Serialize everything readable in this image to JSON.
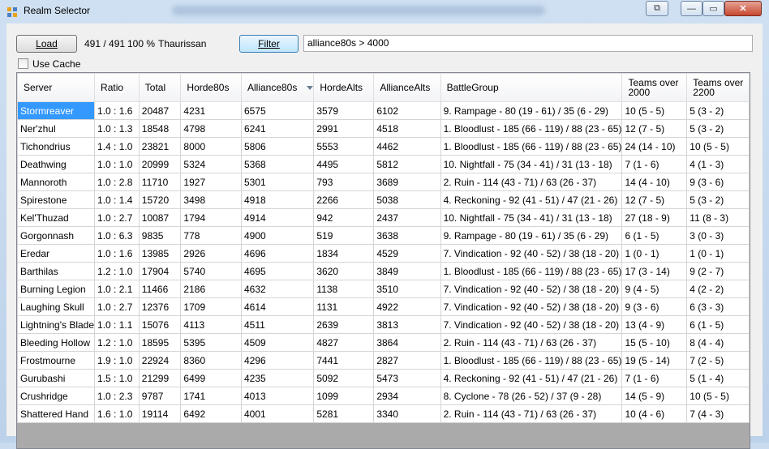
{
  "window": {
    "title": "Realm Selector",
    "buttons": {
      "restore_extra": "⧉",
      "minimize": "—",
      "maximize": "▭",
      "close": "✕"
    }
  },
  "toolbar": {
    "load_label": "Load",
    "count_text": "491 / 491",
    "percent_text": "100 %",
    "realm_name": "Thaurissan",
    "filter_label": "Filter",
    "filter_value": "alliance80s > 4000",
    "use_cache_label": "Use Cache"
  },
  "table": {
    "columns": [
      "Server",
      "Ratio",
      "Total",
      "Horde80s",
      "Alliance80s",
      "HordeAlts",
      "AllianceAlts",
      "BattleGroup",
      "Teams over 2000",
      "Teams over 2200"
    ],
    "rows": [
      [
        "Stormreaver",
        "1.0 : 1.6",
        "20487",
        "4231",
        "6575",
        "3579",
        "6102",
        "9.  Rampage - 80 (19 - 61) / 35 (6 - 29)",
        "10 (5 - 5)",
        "5 (3 - 2)"
      ],
      [
        "Ner'zhul",
        "1.0 : 1.3",
        "18548",
        "4798",
        "6241",
        "2991",
        "4518",
        "1.  Bloodlust - 185 (66 - 119) / 88 (23 - 65)",
        "12 (7 - 5)",
        "5 (3 - 2)"
      ],
      [
        "Tichondrius",
        "1.4 : 1.0",
        "23821",
        "8000",
        "5806",
        "5553",
        "4462",
        "1.  Bloodlust - 185 (66 - 119) / 88 (23 - 65)",
        "24 (14 - 10)",
        "10 (5 - 5)"
      ],
      [
        "Deathwing",
        "1.0 : 1.0",
        "20999",
        "5324",
        "5368",
        "4495",
        "5812",
        "10.  Nightfall - 75 (34 - 41) / 31 (13 - 18)",
        "7 (1 - 6)",
        "4 (1 - 3)"
      ],
      [
        "Mannoroth",
        "1.0 : 2.8",
        "11710",
        "1927",
        "5301",
        "793",
        "3689",
        "2.  Ruin - 114 (43 - 71) / 63 (26 - 37)",
        "14 (4 - 10)",
        "9 (3 - 6)"
      ],
      [
        "Spirestone",
        "1.0 : 1.4",
        "15720",
        "3498",
        "4918",
        "2266",
        "5038",
        "4.  Reckoning - 92 (41 - 51) / 47 (21 - 26)",
        "12 (7 - 5)",
        "5 (3 - 2)"
      ],
      [
        "Kel'Thuzad",
        "1.0 : 2.7",
        "10087",
        "1794",
        "4914",
        "942",
        "2437",
        "10.  Nightfall - 75 (34 - 41) / 31 (13 - 18)",
        "27 (18 - 9)",
        "11 (8 - 3)"
      ],
      [
        "Gorgonnash",
        "1.0 : 6.3",
        "9835",
        "778",
        "4900",
        "519",
        "3638",
        "9.  Rampage - 80 (19 - 61) / 35 (6 - 29)",
        "6 (1 - 5)",
        "3 (0 - 3)"
      ],
      [
        "Eredar",
        "1.0 : 1.6",
        "13985",
        "2926",
        "4696",
        "1834",
        "4529",
        "7.  Vindication - 92 (40 - 52) / 38 (18 - 20)",
        "1 (0 - 1)",
        "1 (0 - 1)"
      ],
      [
        "Barthilas",
        "1.2 : 1.0",
        "17904",
        "5740",
        "4695",
        "3620",
        "3849",
        "1.  Bloodlust - 185 (66 - 119) / 88 (23 - 65)",
        "17 (3 - 14)",
        "9 (2 - 7)"
      ],
      [
        "Burning Legion",
        "1.0 : 2.1",
        "11466",
        "2186",
        "4632",
        "1138",
        "3510",
        "7.  Vindication - 92 (40 - 52) / 38 (18 - 20)",
        "9 (4 - 5)",
        "4 (2 - 2)"
      ],
      [
        "Laughing Skull",
        "1.0 : 2.7",
        "12376",
        "1709",
        "4614",
        "1131",
        "4922",
        "7.  Vindication - 92 (40 - 52) / 38 (18 - 20)",
        "9 (3 - 6)",
        "6 (3 - 3)"
      ],
      [
        "Lightning's Blade",
        "1.0 : 1.1",
        "15076",
        "4113",
        "4511",
        "2639",
        "3813",
        "7.  Vindication - 92 (40 - 52) / 38 (18 - 20)",
        "13 (4 - 9)",
        "6 (1 - 5)"
      ],
      [
        "Bleeding Hollow",
        "1.2 : 1.0",
        "18595",
        "5395",
        "4509",
        "4827",
        "3864",
        "2.  Ruin - 114 (43 - 71) / 63 (26 - 37)",
        "15 (5 - 10)",
        "8 (4 - 4)"
      ],
      [
        "Frostmourne",
        "1.9 : 1.0",
        "22924",
        "8360",
        "4296",
        "7441",
        "2827",
        "1.  Bloodlust - 185 (66 - 119) / 88 (23 - 65)",
        "19 (5 - 14)",
        "7 (2 - 5)"
      ],
      [
        "Gurubashi",
        "1.5 : 1.0",
        "21299",
        "6499",
        "4235",
        "5092",
        "5473",
        "4.  Reckoning - 92 (41 - 51) / 47 (21 - 26)",
        "7 (1 - 6)",
        "5 (1 - 4)"
      ],
      [
        "Crushridge",
        "1.0 : 2.3",
        "9787",
        "1741",
        "4013",
        "1099",
        "2934",
        "8.  Cyclone - 78 (26 - 52) / 37 (9 - 28)",
        "14 (5 - 9)",
        "10 (5 - 5)"
      ],
      [
        "Shattered Hand",
        "1.6 : 1.0",
        "19114",
        "6492",
        "4001",
        "5281",
        "3340",
        "2.  Ruin - 114 (43 - 71) / 63 (26 - 37)",
        "10 (4 - 6)",
        "7 (4 - 3)"
      ]
    ]
  },
  "colors": {
    "selection": "#3399ff",
    "titlebar": "#cfe0f2",
    "close_button": "#c7472f"
  }
}
